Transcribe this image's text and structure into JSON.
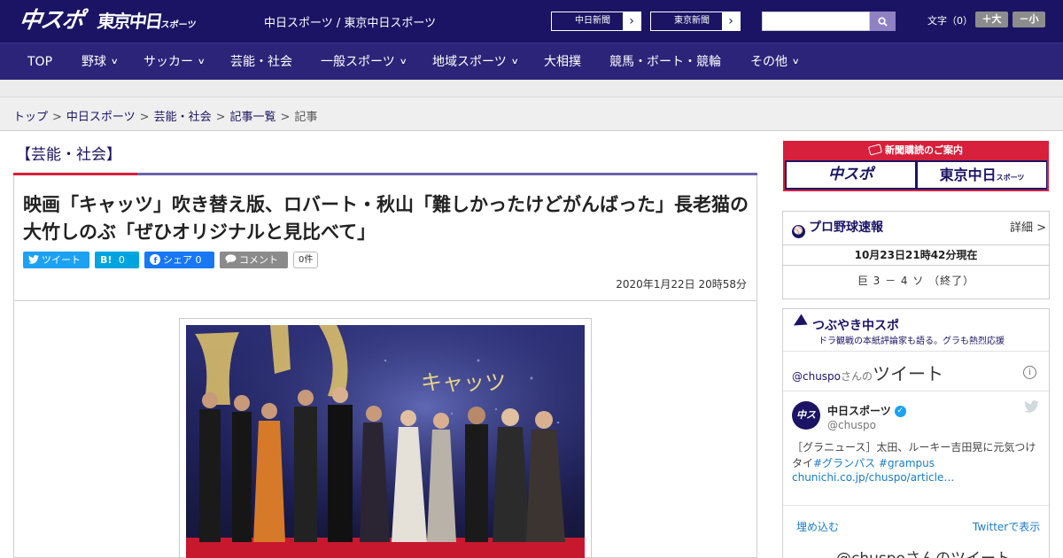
{
  "header": {
    "logo_chuspo": "中スポ",
    "logo_tokyo": "東京中日",
    "logo_tokyo_small": "スポーツ",
    "site_title": "中日スポーツ / 東京中日スポーツ",
    "links": [
      {
        "label": "中日新聞",
        "arrow": "›"
      },
      {
        "label": "東京新聞",
        "arrow": "›"
      }
    ],
    "search_placeholder": "",
    "font_size_label": "文字（0）",
    "font_increase": "＋大",
    "font_decrease": "－小"
  },
  "nav": {
    "items": [
      {
        "label": "TOP",
        "has_dropdown": false
      },
      {
        "label": "野球",
        "has_dropdown": true
      },
      {
        "label": "サッカー",
        "has_dropdown": true
      },
      {
        "label": "芸能・社会",
        "has_dropdown": false
      },
      {
        "label": "一般スポーツ",
        "has_dropdown": true
      },
      {
        "label": "地域スポーツ",
        "has_dropdown": true
      },
      {
        "label": "大相撲",
        "has_dropdown": false
      },
      {
        "label": "競馬・ボート・競輪",
        "has_dropdown": false
      },
      {
        "label": "その他",
        "has_dropdown": true
      }
    ],
    "chevron": "﹀"
  },
  "breadcrumb": {
    "items": [
      "トップ",
      "中日スポーツ",
      "芸能・社会",
      "記事一覧"
    ],
    "current": "記事",
    "separator": ">"
  },
  "article": {
    "category": "【芸能・社会】",
    "headline": "映画「キャッツ」吹き替え版、ロバート・秋山「難しかったけどがんばった」長老猫の大竹しのぶ「ぜひオリジナルと見比べて」",
    "share": {
      "tweet": "ツイート",
      "hatena_icon": "B!",
      "hatena_count": "0",
      "facebook": "シェア 0",
      "comment": "コメント",
      "comment_count": "0件"
    },
    "date": "2020年1月22日 20時58分",
    "photo_caption_sign": "キャッツ"
  },
  "sidebar": {
    "subscription": {
      "title": "新聞購読のご案内",
      "logo_left": "中スポ",
      "logo_right": "東京中日",
      "logo_right_small": "スポーツ"
    },
    "baseball": {
      "title": "プロ野球速報",
      "more": "詳細 >",
      "timestamp": "10月23日21時42分現在",
      "score": "巨 3 － 4 ソ （終了）"
    },
    "tweets": {
      "title": "つぶやき中スポ",
      "subtitle": "ドラ観戦の本紙評論家も語る。グラも熱烈応援",
      "handle_prefix": "@chuspo",
      "handle_suffix": "さんの",
      "heading_big": "ツイート",
      "info_icon": "i",
      "account_name": "中日スポーツ",
      "account_handle": "@chuspo",
      "tweet_text": "［グラニュース］太田、ルーキー吉田晃に元気つけタイ",
      "tweet_tags": "#グランパス #grampus",
      "tweet_link": "chunichi.co.jp/chuspo/article…",
      "embed": "埋め込む",
      "view_on": "Twitterで表示",
      "bottom": "@chuspoさんのツイート",
      "verified_mark": "✓",
      "avatar_text": "中スポ"
    }
  },
  "colors": {
    "brand_navy": "#1b1464",
    "nav_bg": "#2c2478",
    "accent_red": "#d7203c",
    "twitter_blue": "#1da1f2",
    "facebook_blue": "#1877f2"
  },
  "icons": [
    "search-icon",
    "chevron-down-icon",
    "twitter-icon",
    "facebook-icon",
    "comment-icon",
    "baseball-icon",
    "megaphone-icon",
    "info-icon",
    "verified-icon",
    "newspaper-icon"
  ]
}
